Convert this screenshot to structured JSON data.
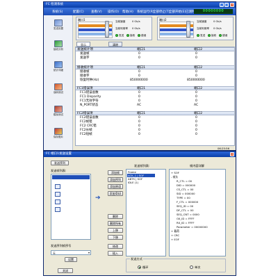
{
  "window1": {
    "title": "FC 检测系统",
    "menu": [
      "系统(S)",
      "配置(C)",
      "查看(V)",
      "操作(O)",
      "帮助(H)",
      "系统运行(R)",
      "全部停止(T)",
      "全部开始(E)",
      "已测时间"
    ],
    "clock": "00000000",
    "sidebar": [
      "发送设置",
      "接收分析",
      "统计详细",
      "误码测试",
      "模拟测试",
      "保存图片"
    ],
    "ports": [
      {
        "name": "端口1",
        "speed_label": "当前速度",
        "speed_value": "0 Gb/s",
        "ratio_label": "当前利用率",
        "ratio_value": "0 Gb/s",
        "status_tx": "发送",
        "status_rx": "接收",
        "status_err": "错误"
      },
      {
        "name": "端口2",
        "speed_label": "当前速度",
        "speed_value": "0 Gb/s",
        "ratio_label": "当前利用率",
        "ratio_value": "0 Gb/s",
        "status_tx": "发送",
        "status_rx": "接收",
        "status_err": "错误"
      }
    ],
    "tabs": [
      "显示",
      "清除"
    ],
    "table": {
      "sections": [
        {
          "title": "发送统计项",
          "col1": "端口1",
          "col2": "端口2",
          "rows": [
            {
              "label": "发送帧",
              "v1": "0",
              "v2": "0"
            },
            {
              "label": "发送字",
              "v1": "0",
              "v2": "0"
            }
          ]
        },
        {
          "title": "接收统计项",
          "col1": "端口1",
          "col2": "端口2",
          "rows": [
            {
              "label": "接收帧",
              "v1": "0",
              "v2": "0"
            },
            {
              "label": "接收字",
              "v1": "0",
              "v2": "0"
            },
            {
              "label": "恢复时钟(Hz)",
              "v1": "850000000",
              "v2": "850000000"
            }
          ]
        },
        {
          "title": "FC1错误项",
          "col1": "端口1",
          "col2": "端口2",
          "rows": [
            {
              "label": "FC1错误总数",
              "v1": "0",
              "v2": "0"
            },
            {
              "label": "FC1 Disparity",
              "v1": "0",
              "v2": "0"
            },
            {
              "label": "FC1无效字符",
              "v1": "0",
              "v2": "0"
            },
            {
              "label": "N_PORT状态",
              "v1": "AC",
              "v2": "AC"
            }
          ]
        },
        {
          "title": "FC2错误项",
          "col1": "端口1",
          "col2": "端口2",
          "rows": [
            {
              "label": "FC2错误总数",
              "v1": "0",
              "v2": "0"
            },
            {
              "label": "FC2帧错",
              "v1": "0",
              "v2": "0"
            },
            {
              "label": "FC2 CRC错",
              "v1": "0",
              "v2": "0"
            },
            {
              "label": "FC2长帧",
              "v1": "0",
              "v2": "0"
            },
            {
              "label": "FC2短帧",
              "v1": "0",
              "v2": "0"
            }
          ]
        }
      ]
    },
    "footer_time": "06:25:56"
  },
  "window2": {
    "title": "FC 端口1发送设置",
    "send_btn": "发送序列",
    "list_label": "发送帧列表:",
    "frames_label": "发送帧列表:",
    "frames": [
      "Frame",
      "ACK_1 | SOF",
      "ABTS | SOF",
      "IDLE (1)"
    ],
    "detail_label": "帧内容详解",
    "tree": [
      "+ SOF",
      "- 帧头",
      "R_CTL = 00",
      "DID = 000000",
      "CS_CTL = 00",
      "SID = 000000",
      "TYPE = 00",
      "F_CTL = 000000",
      "SEQ_ID = 00",
      "DF_CTL = 00",
      "SEQ_CNT = 0000",
      "OX_ID = FFFF",
      "RX_ID = FFFF",
      "Parameter = 00000000",
      "+ 载荷",
      "+ CRC",
      "+ EOF"
    ],
    "mid_buttons": [
      "添加帧",
      "添加序列",
      "添加原语",
      "添加IDLE"
    ],
    "mid_buttons2": [
      "删除",
      "删除所有",
      "上移",
      "下移",
      "修改",
      "插入"
    ],
    "mode_label": "发送方式",
    "modes": [
      "循环",
      "单次"
    ],
    "seq_label": "发送序列帧序号",
    "select_value": "无",
    "ok_btn": "设置",
    "close_btn": "关闭"
  },
  "colors": {
    "accent": "#2b66d9",
    "title_bg": "#0a3fa8",
    "clock_fg": "#38ff5b",
    "selection": "#1f4fb8"
  }
}
